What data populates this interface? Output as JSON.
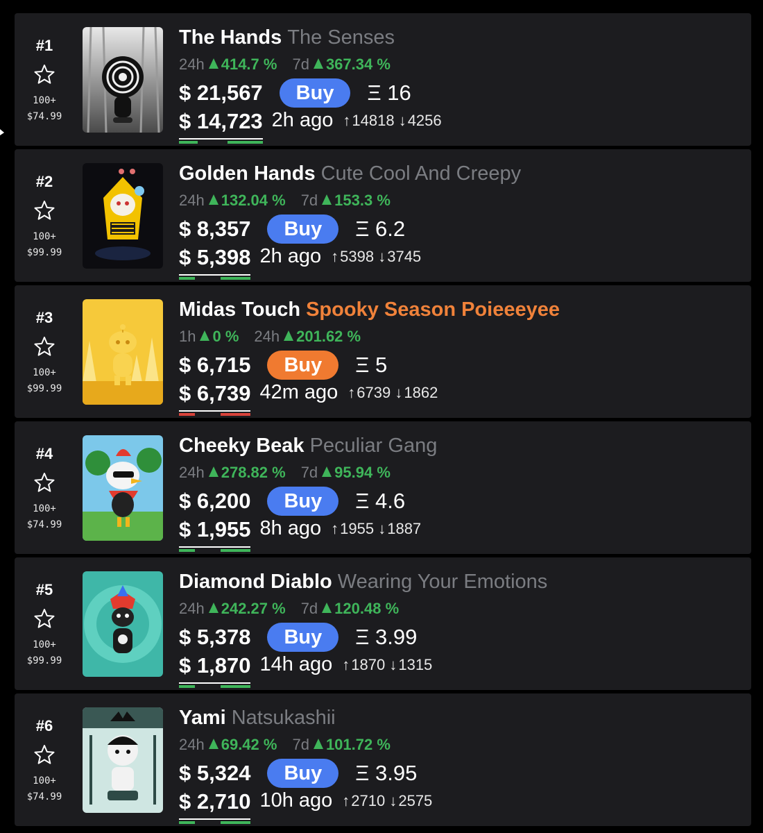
{
  "colors": {
    "background": "#000000",
    "card": "#1c1c1f",
    "up_green": "#3fb55a",
    "buy_blue": "#4a7cf0",
    "buy_orange": "#f07a30",
    "muted_gray": "#7b7d82",
    "down_red": "#d9433b"
  },
  "icons": {
    "favorite": "star-outline-icon",
    "up": "triangle-up-icon",
    "volume_up": "arrow-up-icon",
    "volume_down": "arrow-down-icon"
  },
  "items": [
    {
      "rank": "#1",
      "count": "100+",
      "pack_price": "$74.99",
      "name": "The Hands",
      "subtitle": "The Senses",
      "subtitle_style": "gray",
      "change1_period": "24h",
      "change1_value": "414.7 %",
      "change2_period": "7d",
      "change2_value": "367.34 %",
      "price": "$ 21,567",
      "buy_label": "Buy",
      "buy_style": "blue",
      "eth": "Ξ 16",
      "last_price": "$ 14,723",
      "last_style": "green",
      "time_ago": "2h ago",
      "vol_up": "14818",
      "vol_down": "4256",
      "image": "the-hands-artwork"
    },
    {
      "rank": "#2",
      "count": "100+",
      "pack_price": "$99.99",
      "name": "Golden Hands",
      "subtitle": "Cute Cool And Creepy",
      "subtitle_style": "gray",
      "change1_period": "24h",
      "change1_value": "132.04 %",
      "change2_period": "7d",
      "change2_value": "153.3 %",
      "price": "$ 8,357",
      "buy_label": "Buy",
      "buy_style": "blue",
      "eth": "Ξ 6.2",
      "last_price": "$ 5,398",
      "last_style": "green",
      "time_ago": "2h ago",
      "vol_up": "5398",
      "vol_down": "3745",
      "image": "golden-hands-artwork"
    },
    {
      "rank": "#3",
      "count": "100+",
      "pack_price": "$99.99",
      "name": "Midas Touch",
      "subtitle": "Spooky Season Poieeeyee",
      "subtitle_style": "orange",
      "change1_period": "1h",
      "change1_value": "0 %",
      "change2_period": "24h",
      "change2_value": "201.62 %",
      "price": "$ 6,715",
      "buy_label": "Buy",
      "buy_style": "orange",
      "eth": "Ξ 5",
      "last_price": "$ 6,739",
      "last_style": "red",
      "time_ago": "42m ago",
      "vol_up": "6739",
      "vol_down": "1862",
      "image": "midas-touch-artwork"
    },
    {
      "rank": "#4",
      "count": "100+",
      "pack_price": "$74.99",
      "name": "Cheeky Beak",
      "subtitle": "Peculiar Gang",
      "subtitle_style": "gray",
      "change1_period": "24h",
      "change1_value": "278.82 %",
      "change2_period": "7d",
      "change2_value": "95.94 %",
      "price": "$ 6,200",
      "buy_label": "Buy",
      "buy_style": "blue",
      "eth": "Ξ 4.6",
      "last_price": "$ 1,955",
      "last_style": "green",
      "time_ago": "8h ago",
      "vol_up": "1955",
      "vol_down": "1887",
      "image": "cheeky-beak-artwork"
    },
    {
      "rank": "#5",
      "count": "100+",
      "pack_price": "$99.99",
      "name": "Diamond Diablo",
      "subtitle": "Wearing Your Emotions",
      "subtitle_style": "gray",
      "change1_period": "24h",
      "change1_value": "242.27 %",
      "change2_period": "7d",
      "change2_value": "120.48 %",
      "price": "$ 5,378",
      "buy_label": "Buy",
      "buy_style": "blue",
      "eth": "Ξ 3.99",
      "last_price": "$ 1,870",
      "last_style": "green",
      "time_ago": "14h ago",
      "vol_up": "1870",
      "vol_down": "1315",
      "image": "diamond-diablo-artwork"
    },
    {
      "rank": "#6",
      "count": "100+",
      "pack_price": "$74.99",
      "name": "Yami",
      "subtitle": "Natsukashii",
      "subtitle_style": "gray",
      "change1_period": "24h",
      "change1_value": "69.42 %",
      "change2_period": "7d",
      "change2_value": "101.72 %",
      "price": "$ 5,324",
      "buy_label": "Buy",
      "buy_style": "blue",
      "eth": "Ξ 3.95",
      "last_price": "$ 2,710",
      "last_style": "green",
      "time_ago": "10h ago",
      "vol_up": "2710",
      "vol_down": "2575",
      "image": "yami-artwork"
    }
  ]
}
